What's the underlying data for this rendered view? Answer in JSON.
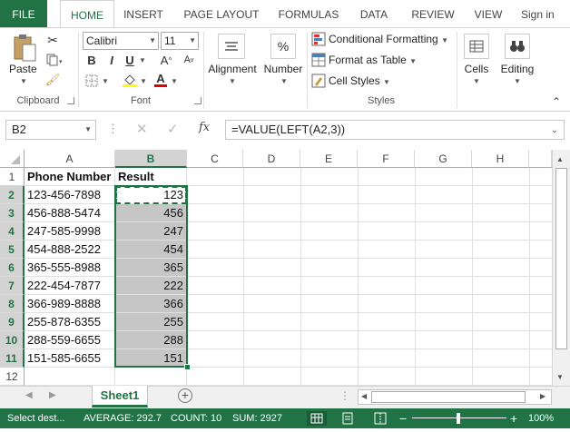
{
  "tabs": [
    "FILE",
    "HOME",
    "INSERT",
    "PAGE LAYOUT",
    "FORMULAS",
    "DATA",
    "REVIEW",
    "VIEW",
    "Sign in"
  ],
  "ribbon": {
    "clipboard": {
      "paste": "Paste",
      "label": "Clipboard"
    },
    "font": {
      "name": "Calibri",
      "size": "11",
      "bold": "B",
      "italic": "I",
      "underline": "U",
      "grow": "A",
      "shrink": "A",
      "color_a": "A",
      "label": "Font"
    },
    "alignment": {
      "label": "Alignment"
    },
    "number": {
      "label": "Number",
      "icon": "%"
    },
    "styles": {
      "conditional": "Conditional Formatting",
      "table": "Format as Table",
      "cell_styles": "Cell Styles",
      "label": "Styles"
    },
    "cells": {
      "label": "Cells"
    },
    "editing": {
      "label": "Editing"
    }
  },
  "formula_bar": {
    "name_box": "B2",
    "fx": "fx",
    "formula": "=VALUE(LEFT(A2,3))"
  },
  "columns": [
    "A",
    "B",
    "C",
    "D",
    "E",
    "F",
    "G",
    "H"
  ],
  "rows": [
    "1",
    "2",
    "3",
    "4",
    "5",
    "6",
    "7",
    "8",
    "9",
    "10",
    "11",
    "12"
  ],
  "headers": {
    "a": "Phone Number",
    "b": "Result"
  },
  "data": [
    {
      "phone": "123-456-7898",
      "result": "123"
    },
    {
      "phone": "456-888-5474",
      "result": "456"
    },
    {
      "phone": "247-585-9998",
      "result": "247"
    },
    {
      "phone": "454-888-2522",
      "result": "454"
    },
    {
      "phone": "365-555-8988",
      "result": "365"
    },
    {
      "phone": "222-454-7877",
      "result": "222"
    },
    {
      "phone": "366-989-8888",
      "result": "366"
    },
    {
      "phone": "255-878-6355",
      "result": "255"
    },
    {
      "phone": "288-559-6655",
      "result": "288"
    },
    {
      "phone": "151-585-6655",
      "result": "151"
    }
  ],
  "sheet": {
    "name": "Sheet1"
  },
  "status": {
    "mode": "Select dest...",
    "average": "AVERAGE: 292.7",
    "count": "COUNT: 10",
    "sum": "SUM: 2927",
    "zoom": "100%"
  },
  "colors": {
    "accent": "#217346",
    "selection": "#c6c6c6"
  }
}
